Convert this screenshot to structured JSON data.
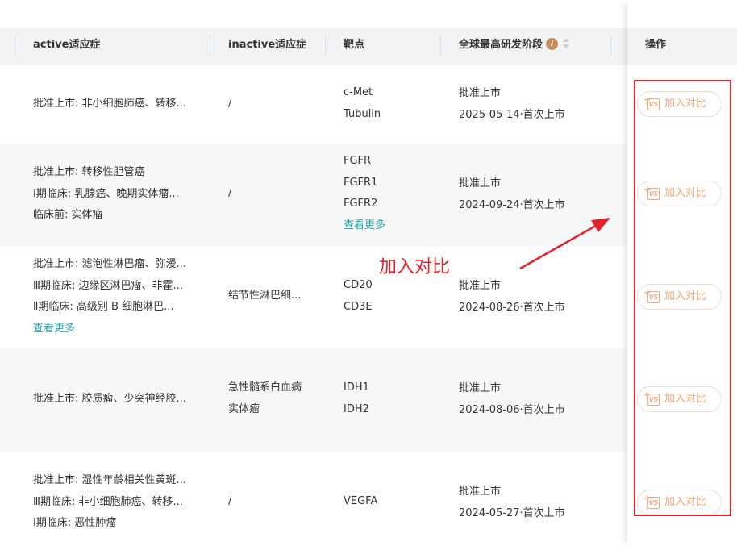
{
  "header": {
    "col_active": "active适应症",
    "col_inactive": "inactive适应症",
    "col_target": "靶点",
    "col_stage": "全球最高研发阶段",
    "col_op": "操作"
  },
  "rows": [
    {
      "active": [
        "批准上市: 非小细胞肺癌、转移..."
      ],
      "inactive": [
        "/"
      ],
      "targets": [
        "c-Met",
        "Tubulin"
      ],
      "target_more": "",
      "active_more": "",
      "stage": "批准上市",
      "stage_date": "2025-05-14·首次上市",
      "op": "加入对比"
    },
    {
      "active": [
        "批准上市: 转移性胆管癌",
        "Ⅰ期临床: 乳腺癌、晚期实体瘤...",
        "临床前: 实体瘤"
      ],
      "inactive": [
        "/"
      ],
      "targets": [
        "FGFR",
        "FGFR1",
        "FGFR2"
      ],
      "target_more": "查看更多",
      "active_more": "",
      "stage": "批准上市",
      "stage_date": "2024-09-24·首次上市",
      "op": "加入对比"
    },
    {
      "active": [
        "批准上市: 滤泡性淋巴瘤、弥漫...",
        "Ⅲ期临床: 边缘区淋巴瘤、非霍...",
        "Ⅱ期临床: 高级别 B 细胞淋巴..."
      ],
      "inactive": [
        "结节性淋巴细..."
      ],
      "targets": [
        "CD20",
        "CD3E"
      ],
      "target_more": "",
      "active_more": "查看更多",
      "stage": "批准上市",
      "stage_date": "2024-08-26·首次上市",
      "op": "加入对比"
    },
    {
      "active": [
        "批准上市: 胶质瘤、少突神经胶..."
      ],
      "inactive": [
        "急性髓系白血病",
        "实体瘤"
      ],
      "targets": [
        "IDH1",
        "IDH2"
      ],
      "target_more": "",
      "active_more": "",
      "stage": "批准上市",
      "stage_date": "2024-08-06·首次上市",
      "op": "加入对比"
    },
    {
      "active": [
        "批准上市: 湿性年龄相关性黄斑...",
        "Ⅲ期临床: 非小细胞肺癌、转移...",
        "Ⅰ期临床: 恶性肿瘤"
      ],
      "inactive": [
        "/"
      ],
      "targets": [
        "VEGFA"
      ],
      "target_more": "",
      "active_more": "",
      "stage": "批准上市",
      "stage_date": "2024-05-27·首次上市",
      "op": "加入对比"
    }
  ],
  "annotation": {
    "text": "加入对比",
    "color": "#e0242a"
  },
  "icons": {
    "info": "info-icon",
    "sort": "sort-icon",
    "compare": "vs-compare-icon"
  },
  "colors": {
    "link": "#27a3a8",
    "button_text": "#f0a77a",
    "header_bg": "#f2f3f5",
    "alt_row_bg": "#f7f8fa"
  }
}
